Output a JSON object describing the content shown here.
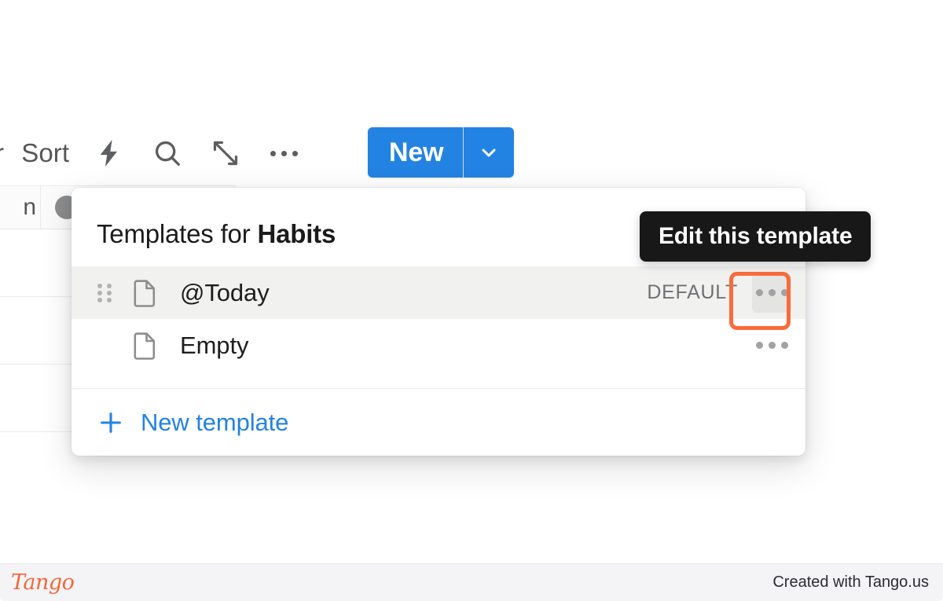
{
  "toolbar": {
    "partial_label": "r",
    "sort_label": "Sort",
    "icons": [
      {
        "name": "lightning-icon",
        "label": "Automations"
      },
      {
        "name": "search-icon",
        "label": "Search"
      },
      {
        "name": "expand-icon",
        "label": "Expand"
      },
      {
        "name": "more-options-icon",
        "label": "More options"
      }
    ],
    "new_button": {
      "label": "New",
      "caret": "chevron-down-icon",
      "color": "#2383e2"
    }
  },
  "popup": {
    "title_prefix": "Templates for ",
    "title_target": "Habits",
    "templates": [
      {
        "name": "@Today",
        "badge": "DEFAULT",
        "selected": true,
        "has_drag_handle": true,
        "menu_active": true
      },
      {
        "name": "Empty",
        "badge": "",
        "selected": false,
        "has_drag_handle": false,
        "menu_active": false
      }
    ],
    "new_template_label": "New template",
    "new_template_color": "#2383e2"
  },
  "tooltip": {
    "text": "Edit this template",
    "background": "#181818",
    "highlight_color": "#fa6a3b"
  },
  "footer": {
    "logo_text": "Tango",
    "right_text": "Created with Tango.us"
  }
}
